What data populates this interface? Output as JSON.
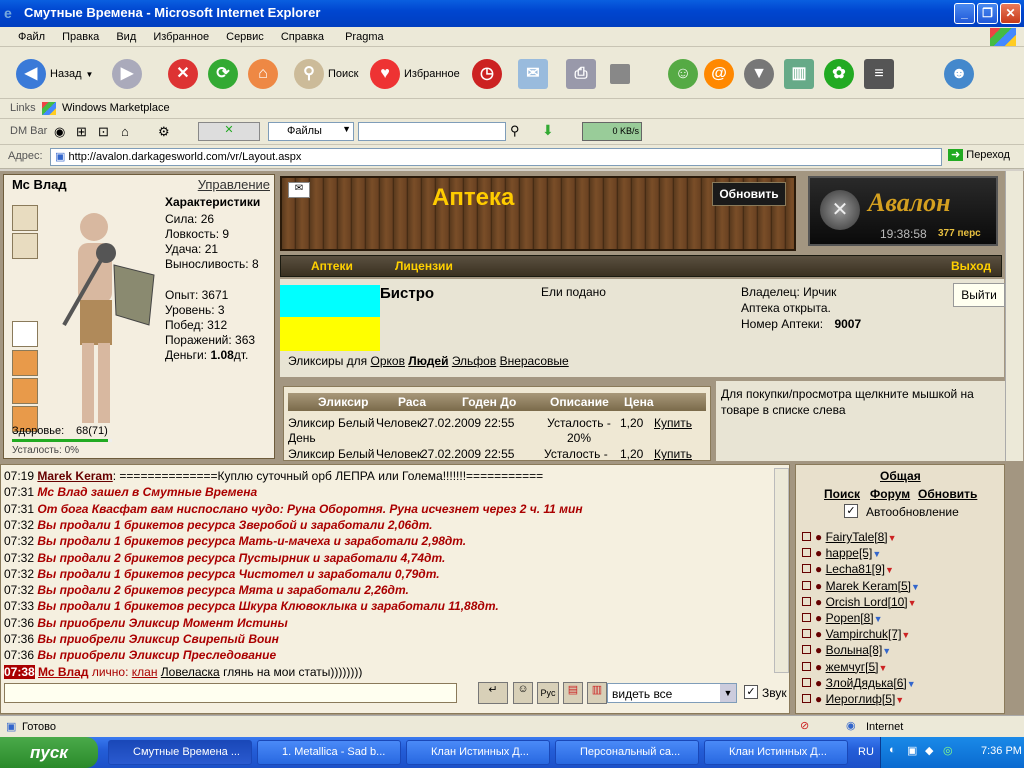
{
  "window": {
    "title": "Смутные Времена - Microsoft Internet Explorer"
  },
  "menu": [
    "Файл",
    "Правка",
    "Вид",
    "Избранное",
    "Сервис",
    "Справка",
    "Pragma"
  ],
  "toolbar": {
    "back": "Назад",
    "search": "Поиск",
    "favorites": "Избранное"
  },
  "links": {
    "label": "Links",
    "item": "Windows Marketplace"
  },
  "dmbar": {
    "label": "DM Bar",
    "files": "Файлы",
    "speed": "0 KB/s"
  },
  "address": {
    "label": "Адрес:",
    "url": "http://avalon.darkagesworld.com/vr/Layout.aspx",
    "go": "Переход"
  },
  "player": {
    "name": "Мс Влад",
    "manage": "Управление",
    "stats_title": "Характеристики",
    "strength": "Сила: 26",
    "agility": "Ловкость: 9",
    "luck": "Удача: 21",
    "stamina": "Выносливость: 8",
    "exp": "Опыт: 3671",
    "level": "Уровень: 3",
    "wins": "Побед: 312",
    "losses": "Поражений: 363",
    "money_label": "Деньги:",
    "money_value": "1.08",
    "money_unit": "дт.",
    "health": "Здоровье:",
    "health_value": "68(71)",
    "health_fraction": 0.958,
    "extra": "Усталость: 0%"
  },
  "shop": {
    "title": "Аптека",
    "refresh": "Обновить",
    "logo": "Авалон",
    "time": "19:38:58",
    "count": "377 перс",
    "nav": [
      "Аптеки",
      "Лицензии",
      "Выход"
    ],
    "shop_name": "Бистро",
    "motto": "Ели подано",
    "owner": "Владелец: Ирчик",
    "status": "Аптека открыта.",
    "number_label": "Номер Аптеки:",
    "number": "9007",
    "exit": "Выйти",
    "filter_label": "Эликсиры для",
    "filters": [
      "Орков",
      "Людей",
      "Эльфов",
      "Внерасовые"
    ],
    "help": "Для покупки/просмотра щелкните мышкой на товаре в списке слева",
    "columns": [
      "Эликсир",
      "Раса",
      "Годен До",
      "Описание",
      "Цена"
    ],
    "rows": [
      {
        "name": "Эликсир Белый",
        "name2": "День",
        "race": "Человек",
        "date": "27.02.2009 22:55",
        "desc": "Усталость - 20%",
        "price": "1,20",
        "buy": "Купить"
      },
      {
        "name": "Эликсир Белый",
        "race": "Человек",
        "date": "27.02.2009 22:55",
        "desc": "Усталость -",
        "price": "1,20",
        "buy": "Купить"
      }
    ]
  },
  "chat": {
    "messages": [
      {
        "time": "07:19",
        "author": "Marek Keram",
        "text": ": ==============Куплю суточный орб ЛЕПРА или Голема!!!!!!!===========",
        "sys": false
      },
      {
        "time": "07:31",
        "text": "Мс Влад зашел в Смутные Времена",
        "sys": true
      },
      {
        "time": "07:31",
        "text": "От бога Квасфат вам ниспослано чудо: Руна Оборотня. Руна исчезнет через 2 ч. 11 мин",
        "sys": true
      },
      {
        "time": "07:32",
        "text": "Вы продали 1 брикетов ресурса Зверобой и заработали 2,06дт.",
        "sys": true
      },
      {
        "time": "07:32",
        "text": "Вы продали 1 брикетов ресурса Мать-и-мачеха и заработали 2,98дт.",
        "sys": true
      },
      {
        "time": "07:32",
        "text": "Вы продали 2 брикетов ресурса Пустырник и заработали 4,74дт.",
        "sys": true
      },
      {
        "time": "07:32",
        "text": "Вы продали 1 брикетов ресурса Чистотел и заработали 0,79дт.",
        "sys": true
      },
      {
        "time": "07:32",
        "text": "Вы продали 2 брикетов ресурса Мята и заработали 2,26дт.",
        "sys": true
      },
      {
        "time": "07:33",
        "text": "Вы продали 1 брикетов ресурса Шкура Клювоклыка и заработали 11,88дт.",
        "sys": true
      },
      {
        "time": "07:36",
        "text": "Вы приобрели Эликсир Момент Истины",
        "sys": true
      },
      {
        "time": "07:36",
        "text": "Вы приобрели Эликсир Свирепый Воин",
        "sys": true
      },
      {
        "time": "07:36",
        "text": "Вы приобрели Эликсир Преследование",
        "sys": true
      }
    ],
    "last": {
      "time": "07:38",
      "author": "Мс Влад",
      "private": "лично:",
      "clan": "клан",
      "target": "Ловеласка",
      "text": "глянь на мои статы))))))))"
    },
    "filter": "видеть все",
    "sound": "Звук"
  },
  "userlist": {
    "tab": "Общая",
    "search": "Поиск",
    "forum": "Форум",
    "refresh": "Обновить",
    "auto": "Автообновление",
    "users": [
      "FairyTale[8]",
      "happe[5]",
      "Lecha81[9]",
      "Marek Keram[5]",
      "Orcish Lord[10]",
      "Popen[8]",
      "Vampirchuk[7]",
      "Волына[8]",
      "жемчуг[5]",
      "ЗлойДядька[6]",
      "Иероглиф[5]"
    ]
  },
  "status": {
    "ready": "Готово",
    "zone": "Internet"
  },
  "taskbar": {
    "start": "пуск",
    "tasks": [
      "Смутные Времена ...",
      "1. Metallica - Sad b...",
      "Клан Истинных Д...",
      "Персональный са...",
      "Клан Истинных Д..."
    ],
    "lang": "RU",
    "clock": "7:36 PM"
  }
}
